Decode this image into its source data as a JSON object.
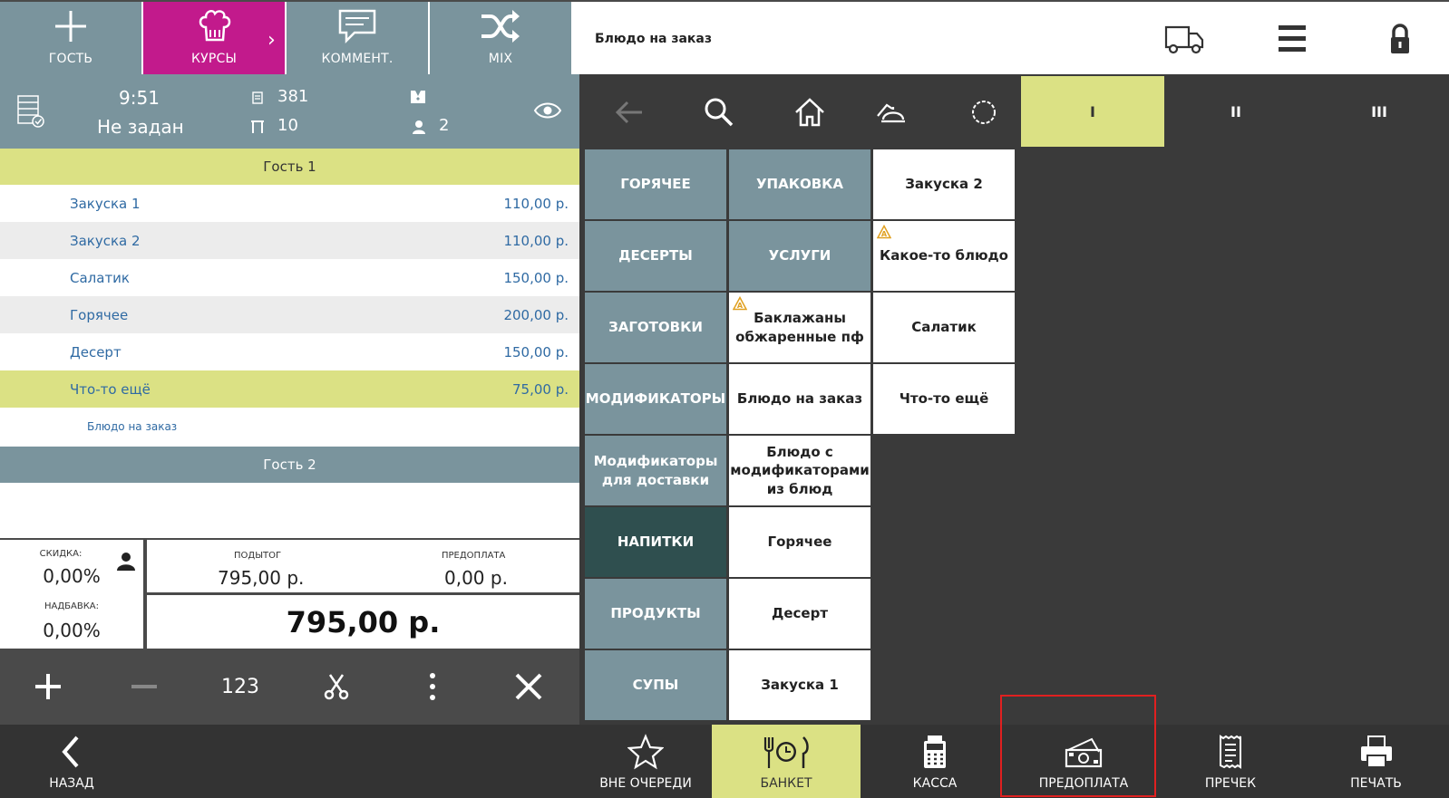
{
  "top_buttons": [
    {
      "label": "ГОСТЬ",
      "icon": "plus-icon"
    },
    {
      "label": "КУРСЫ",
      "icon": "chef-hat-icon",
      "active": true
    },
    {
      "label": "КОММЕНТ.",
      "icon": "comment-icon"
    },
    {
      "label": "MIX",
      "icon": "shuffle-icon"
    }
  ],
  "order_title": "Блюдо на заказ",
  "top_right_icons": [
    "delivery-truck-icon",
    "menu-icon",
    "lock-icon"
  ],
  "info": {
    "time": "9:51",
    "waiter": "Не задан",
    "order_number": "381",
    "table": "10",
    "guests": "2"
  },
  "guest1": {
    "label": "Гость 1",
    "items": [
      {
        "name": "Закуска 1",
        "price": "110,00 р."
      },
      {
        "name": "Закуска 2",
        "price": "110,00 р."
      },
      {
        "name": "Салатик",
        "price": "150,00 р."
      },
      {
        "name": "Горячее",
        "price": "200,00 р."
      },
      {
        "name": "Десерт",
        "price": "150,00 р."
      },
      {
        "name": "Что-то ещё",
        "price": "75,00 р."
      }
    ],
    "modifier": "Блюдо на заказ"
  },
  "guest2": {
    "label": "Гость 2"
  },
  "summary": {
    "discount_label": "СКИДКА:",
    "discount_value": "0,00%",
    "surcharge_label": "НАДБАВКА:",
    "surcharge_value": "0,00%",
    "subtotal_label": "ПОДЫТОГ",
    "subtotal_value": "795,00 р.",
    "prepayment_label": "ПРЕДОПЛАТА",
    "prepayment_value": "0,00 р.",
    "total": "795,00 р."
  },
  "actions": {
    "number_label": "123"
  },
  "courses": [
    "I",
    "II",
    "III"
  ],
  "categories": [
    "ГОРЯЧЕЕ",
    "ДЕСЕРТЫ",
    "ЗАГОТОВКИ",
    "МОДИФИКАТОРЫ",
    "Модификаторы для доставки",
    "НАПИТКИ",
    "ПРОДУКТЫ",
    "СУПЫ"
  ],
  "category_col2": [
    "УПАКОВКА",
    "УСЛУГИ"
  ],
  "dishes_col2": [
    "Баклажаны обжаренные пф",
    "Блюдо на заказ",
    "Блюдо с модификаторами из блюд",
    "Горячее",
    "Десерт",
    "Закуска 1"
  ],
  "dishes_col3": [
    "Закуска 2",
    "Какое-то блюдо",
    "Салатик",
    "Что-то ещё"
  ],
  "bottom": {
    "back": "НАЗАД",
    "out_of_queue": "ВНЕ ОЧЕРЕДИ",
    "banquet": "БАНКЕТ",
    "cash": "КАССА",
    "prepayment": "ПРЕДОПЛАТА",
    "precheck": "ПРЕЧЕК",
    "print": "ПЕЧАТЬ"
  },
  "colors": {
    "slate": "#7a949d",
    "magenta": "#c21a8c",
    "lime": "#dbe184",
    "dark_teal": "#2f4f4f",
    "highlight": "#e02020"
  }
}
